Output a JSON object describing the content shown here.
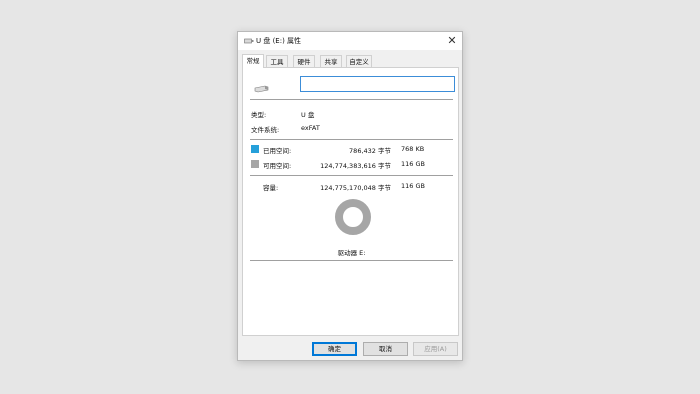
{
  "window": {
    "title": "U 盘 (E:) 属性",
    "close_glyph": "✕"
  },
  "tabs": [
    {
      "label": "常规",
      "active": true
    },
    {
      "label": "工具",
      "active": false
    },
    {
      "label": "硬件",
      "active": false
    },
    {
      "label": "共享",
      "active": false
    },
    {
      "label": "自定义",
      "active": false
    }
  ],
  "general": {
    "name_value": "",
    "type_label": "类型:",
    "type_value": "U 盘",
    "fs_label": "文件系统:",
    "fs_value": "exFAT",
    "used": {
      "label": "已用空间:",
      "bytes": "786,432 字节",
      "size": "768 KB",
      "color": "#26a0da"
    },
    "free": {
      "label": "可用空间:",
      "bytes": "124,774,383,616 字节",
      "size": "116 GB",
      "color": "#a6a6a6"
    },
    "capacity": {
      "label": "容量:",
      "bytes": "124,775,170,048 字节",
      "size": "116 GB"
    },
    "used_fraction": 6.3e-06,
    "drive_label": "驱动器 E:"
  },
  "buttons": {
    "ok": "确定",
    "cancel": "取消",
    "apply": "应用(A)"
  }
}
